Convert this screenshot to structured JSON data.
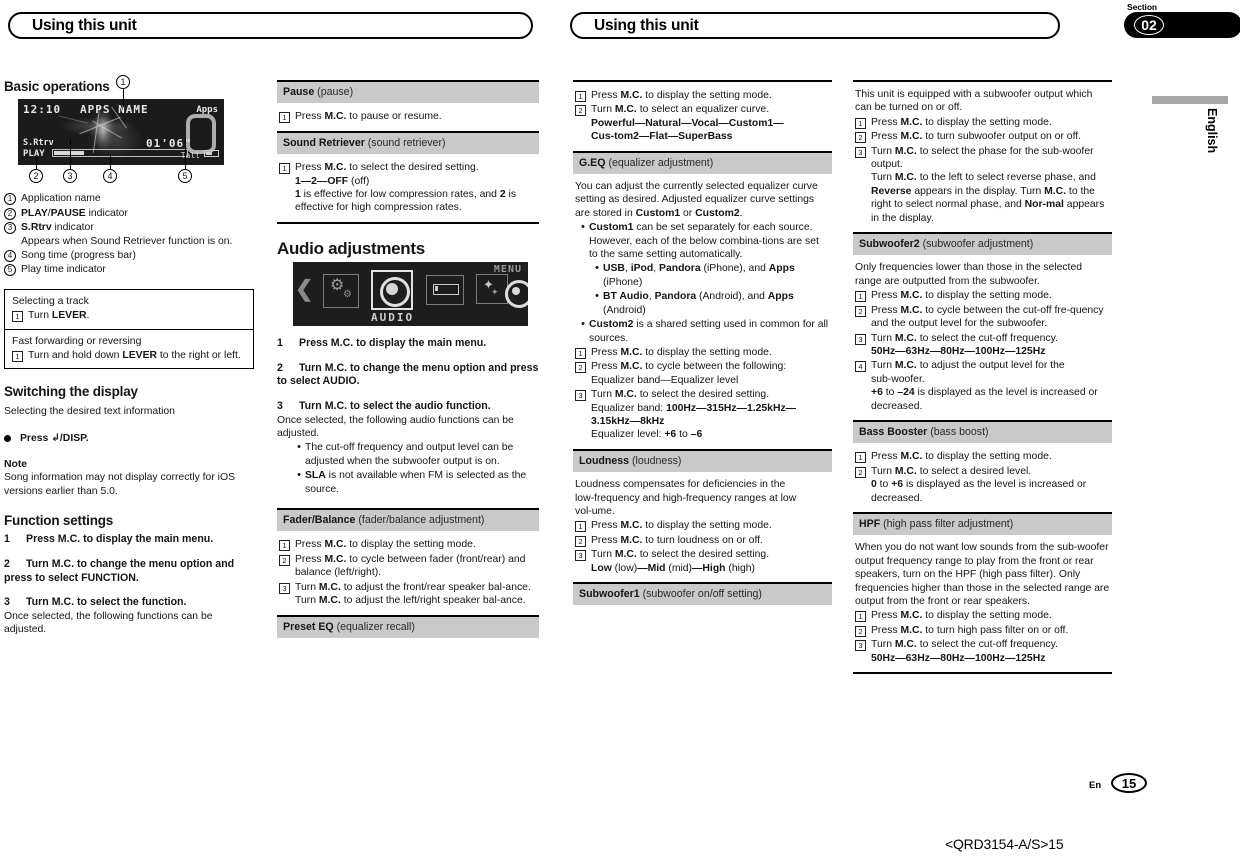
{
  "header": {
    "left_title": "Using this unit",
    "right_title": "Using this unit",
    "section_label": "Section",
    "section_number": "02",
    "language_tab": "English"
  },
  "footer": {
    "lang_code": "En",
    "page_number": "15",
    "doc_code": "<QRD3154-A/S>15"
  },
  "col1": {
    "heading": "Basic operations",
    "lcd": {
      "clock": "12:10",
      "title": "APPS NAME",
      "source_badge": "Apps",
      "sound_retriever": "S.Rtrv",
      "play_state": "PLAY",
      "play_time": "01'06\"",
      "signal": "Tall",
      "callouts": [
        "1",
        "2",
        "3",
        "4",
        "5"
      ]
    },
    "legend": [
      {
        "n": "1",
        "text": "Application name"
      },
      {
        "n": "2",
        "text": "PLAY/PAUSE indicator"
      },
      {
        "n": "3",
        "text": "S.Rtrv indicator"
      },
      {
        "n": "4",
        "text": "Song time (progress bar)"
      },
      {
        "n": "5",
        "text": "Play time indicator"
      }
    ],
    "legend3_note": "Appears when Sound Retriever function is on.",
    "tip1_title": "Selecting a track",
    "tip1_step": "Turn LEVER.",
    "tip2_title": "Fast forwarding or reversing",
    "tip2_step": "Turn and hold down LEVER to the right or left.",
    "switch_heading": "Switching the display",
    "switch_sub": "Selecting the desired text information",
    "switch_bullet": "Press ↰/DISP.",
    "note_heading": "Note",
    "note_body": "Song information may not display correctly for iOS versions earlier than 5.0.",
    "func_heading": "Function settings",
    "func_steps": [
      "Press M.C. to display the main menu.",
      "Turn M.C. to change the menu option and press to select FUNCTION.",
      "Turn M.C. to select the function."
    ],
    "func_after": "Once selected, the following functions can be adjusted."
  },
  "col2": {
    "pause": {
      "name": "Pause",
      "desc": "(pause)",
      "items": [
        {
          "n": "1",
          "text": "Press M.C. to pause or resume."
        }
      ]
    },
    "sound_retriever": {
      "name": "Sound Retriever",
      "desc": "(sound retriever)",
      "items": [
        {
          "n": "1",
          "text": "Press M.C. to select the desired setting."
        }
      ],
      "values": "1—2—OFF (off)",
      "note": "1 is effective for low compression rates, and 2 is effective for high compression rates."
    },
    "audio_heading": "Audio adjustments",
    "audio_art": {
      "menu_label": "MENU",
      "audio_label": "AUDIO"
    },
    "audio_steps": [
      "Press M.C. to display the main menu.",
      "Turn M.C. to change the menu option and press to select AUDIO.",
      "Turn M.C. to select the audio function."
    ],
    "audio_after": "Once selected, the following audio functions can be adjusted.",
    "audio_bullets": [
      "The cut-off frequency and output level can be adjusted when the subwoofer output is on.",
      "SLA is not available when FM is selected as the source."
    ],
    "fader": {
      "name": "Fader/Balance",
      "desc": "(fader/balance adjustment)"
    },
    "fader_items": [
      {
        "n": "1",
        "text": "Press M.C. to display the setting mode."
      },
      {
        "n": "2",
        "text": "Press M.C. to cycle between fader (front/rear) and balance (left/right)."
      },
      {
        "n": "3",
        "text": "Turn M.C. to adjust the front/rear speaker balance."
      }
    ],
    "fader_extra": "Turn M.C. to adjust the left/right speaker balance.",
    "preset_eq": {
      "name": "Preset EQ",
      "desc": "(equalizer recall)"
    }
  },
  "col3": {
    "preset_eq_items": [
      {
        "n": "1",
        "text": "Press M.C. to display the setting mode."
      },
      {
        "n": "2",
        "text": "Turn M.C. to select an equalizer curve."
      }
    ],
    "preset_eq_values": "Powerful—Natural—Vocal—Custom1—Custom2—Flat—SuperBass",
    "geq": {
      "name": "G.EQ",
      "desc": "(equalizer adjustment)"
    },
    "geq_body": "You can adjust the currently selected equalizer curve setting as desired. Adjusted equalizer curve settings are stored in Custom1 or Custom2.",
    "geq_bullet1": "Custom1 can be set separately for each source. However, each of the below combinations are set to the same setting automatically.",
    "geq_sub1": "USB, iPod, Pandora (iPhone), and Apps (iPhone)",
    "geq_sub2": "BT Audio, Pandora (Android), and Apps (Android)",
    "geq_bullet2": "Custom2 is a shared setting used in common for all sources.",
    "geq_items": [
      {
        "n": "1",
        "text": "Press M.C. to display the setting mode."
      },
      {
        "n": "2",
        "text": "Press M.C. to cycle between the following:"
      },
      {
        "n": "3",
        "text": "Turn M.C. to select the desired setting."
      }
    ],
    "geq_cycle": "Equalizer band—Equalizer level",
    "geq_band": "Equalizer band: 100Hz—315Hz—1.25kHz—3.15kHz—8kHz",
    "geq_level": "Equalizer level: +6 to –6",
    "loudness": {
      "name": "Loudness",
      "desc": "(loudness)"
    },
    "loudness_body": "Loudness compensates for deficiencies in the low-frequency and high-frequency ranges at low volume.",
    "loudness_items": [
      {
        "n": "1",
        "text": "Press M.C. to display the setting mode."
      },
      {
        "n": "2",
        "text": "Press M.C. to turn loudness on or off."
      },
      {
        "n": "3",
        "text": "Turn M.C. to select the desired setting."
      }
    ],
    "loudness_values": "Low (low)—Mid (mid)—High (high)",
    "subwoofer1": {
      "name": "Subwoofer1",
      "desc": "(subwoofer on/off setting)"
    }
  },
  "col4": {
    "sub1_body": "This unit is equipped with a subwoofer output which can be turned on or off.",
    "sub1_items": [
      {
        "n": "1",
        "text": "Press M.C. to display the setting mode."
      },
      {
        "n": "2",
        "text": "Press M.C. to turn subwoofer output on or off."
      },
      {
        "n": "3",
        "text": "Turn M.C. to select the phase for the subwoofer output."
      }
    ],
    "sub1_extra": "Turn M.C. to the left to select reverse phase, and Reverse appears in the display. Turn M.C. to the right to select normal phase, and Normal appears in the display.",
    "subwoofer2": {
      "name": "Subwoofer2",
      "desc": "(subwoofer adjustment)"
    },
    "sub2_body": "Only frequencies lower than those in the selected range are outputted from the subwoofer.",
    "sub2_items": [
      {
        "n": "1",
        "text": "Press M.C. to display the setting mode."
      },
      {
        "n": "2",
        "text": "Press M.C. to cycle between the cut-off frequency and the output level for the subwoofer."
      },
      {
        "n": "3",
        "text": "Turn M.C. to select the cut-off frequency."
      },
      {
        "n": "4",
        "text": "Turn M.C. to adjust the output level for the subwoofer."
      }
    ],
    "sub2_freqs": "50Hz—63Hz—80Hz—100Hz—125Hz",
    "sub2_level": "+6 to –24 is displayed as the level is increased or decreased.",
    "bass_booster": {
      "name": "Bass Booster",
      "desc": "(bass boost)"
    },
    "bass_items": [
      {
        "n": "1",
        "text": "Press M.C. to display the setting mode."
      },
      {
        "n": "2",
        "text": "Turn M.C. to select a desired level."
      }
    ],
    "bass_level": "0 to +6 is displayed as the level is increased or decreased.",
    "hpf": {
      "name": "HPF",
      "desc": "(high pass filter adjustment)"
    },
    "hpf_body": "When you do not want low sounds from the subwoofer output frequency range to play from the front or rear speakers, turn on the HPF (high pass filter). Only frequencies higher than those in the selected range are output from the front or rear speakers.",
    "hpf_items": [
      {
        "n": "1",
        "text": "Press M.C. to display the setting mode."
      },
      {
        "n": "2",
        "text": "Press M.C. to turn high pass filter on or off."
      },
      {
        "n": "3",
        "text": "Turn M.C. to select the cut-off frequency."
      }
    ],
    "hpf_freqs": "50Hz—63Hz—80Hz—100Hz—125Hz"
  }
}
